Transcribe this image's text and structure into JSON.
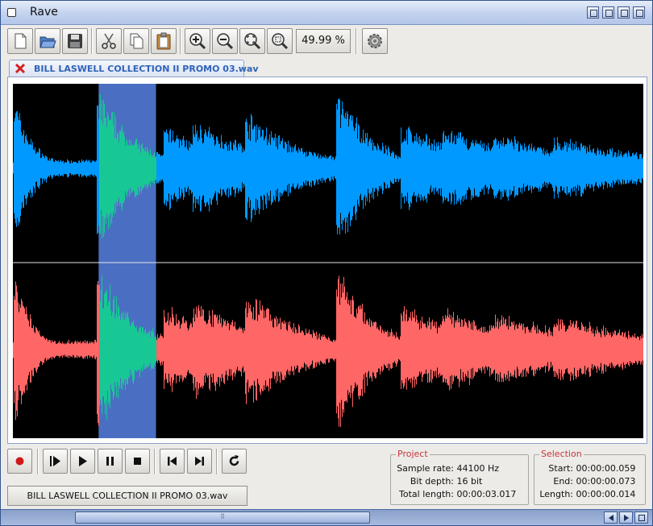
{
  "window": {
    "title": "Rave"
  },
  "toolbar": {
    "buttons": [
      "new-file-icon",
      "open-folder-icon",
      "save-icon",
      "cut-icon",
      "copy-icon",
      "paste-icon",
      "zoom-in-icon",
      "zoom-out-icon",
      "zoom-fit-icon",
      "zoom-selection-icon",
      "settings-gear-icon"
    ],
    "zoom_level": "49.99 %"
  },
  "tab": {
    "label": "BILL LASWELL COLLECTION II PROMO 03.wav",
    "close_icon": "red-x-icon"
  },
  "waveform": {
    "channels": 2,
    "colors": {
      "top": "#0099ff",
      "bottom": "#ff6666",
      "selected_wave": "#17c895",
      "selection_bg": "#4a6fc2",
      "background": "#000000"
    },
    "selection_start_fraction": 0.136,
    "selection_end_fraction": 0.227
  },
  "transport": {
    "buttons": [
      "record-icon",
      "play-selection-icon",
      "play-icon",
      "pause-icon",
      "stop-icon",
      "skip-to-start-icon",
      "skip-to-end-icon",
      "loop-icon"
    ],
    "file_label": "BILL LASWELL COLLECTION II PROMO 03.wav"
  },
  "project": {
    "title": "Project",
    "sample_rate_label": "Sample rate:",
    "sample_rate": "44100 Hz",
    "bit_depth_label": "Bit depth:",
    "bit_depth": "16 bit",
    "total_length_label": "Total length:",
    "total_length": "00:00:03.017"
  },
  "selection": {
    "title": "Selection",
    "start_label": "Start:",
    "start": "00:00:00.059",
    "end_label": "End:",
    "end": "00:00:00.073",
    "length_label": "Length:",
    "length": "00:00:00.014"
  },
  "scrollbar": {
    "grip": "⠿",
    "scroll_fraction": 0.0
  }
}
